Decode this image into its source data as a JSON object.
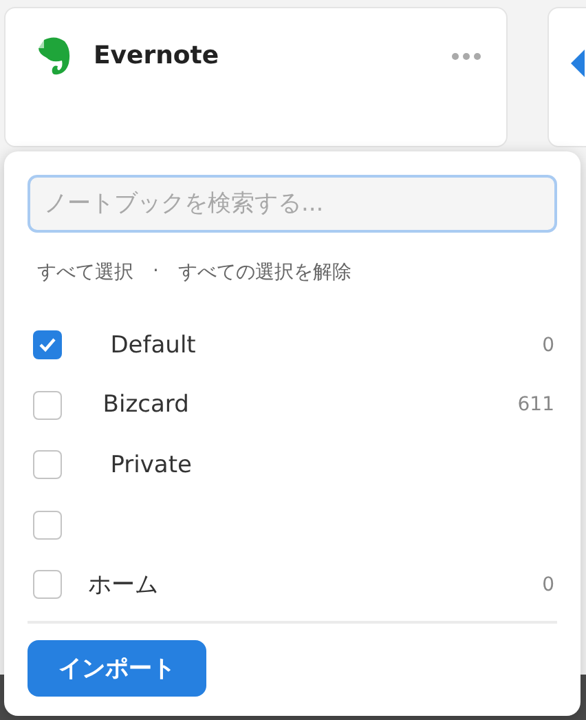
{
  "app_card": {
    "title": "Evernote"
  },
  "notebook_picker": {
    "search": {
      "placeholder": "ノートブックを検索する..."
    },
    "select_all": "すべて選択",
    "separator": "·",
    "deselect_all": "すべての選択を解除",
    "notebooks": [
      {
        "name": "   Default",
        "count": "0",
        "checked": true
      },
      {
        "name": "  Bizcard",
        "count": "611",
        "checked": false
      },
      {
        "name": "   Private",
        "checked": false
      },
      {
        "checked": false
      },
      {
        "name": "ホーム",
        "count": "0",
        "checked": false
      }
    ],
    "import_button": "インポート"
  }
}
